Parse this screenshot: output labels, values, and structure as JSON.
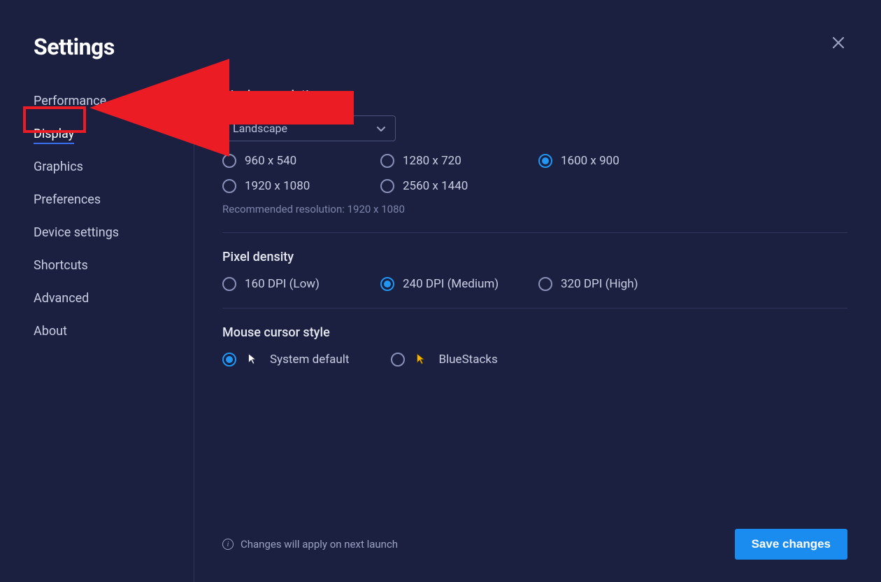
{
  "page_title": "Settings",
  "sidebar": {
    "items": [
      {
        "label": "Performance",
        "active": false
      },
      {
        "label": "Display",
        "active": true
      },
      {
        "label": "Graphics",
        "active": false
      },
      {
        "label": "Preferences",
        "active": false
      },
      {
        "label": "Device settings",
        "active": false
      },
      {
        "label": "Shortcuts",
        "active": false
      },
      {
        "label": "Advanced",
        "active": false
      },
      {
        "label": "About",
        "active": false
      }
    ]
  },
  "display": {
    "resolution": {
      "title": "Display resolution",
      "selector_label": "Landscape",
      "options": [
        {
          "label": "960 x 540",
          "selected": false
        },
        {
          "label": "1280 x 720",
          "selected": false
        },
        {
          "label": "1600 x 900",
          "selected": true
        },
        {
          "label": "1920 x 1080",
          "selected": false
        },
        {
          "label": "2560 x 1440",
          "selected": false
        }
      ],
      "hint": "Recommended resolution: 1920 x 1080"
    },
    "pixel_density": {
      "title": "Pixel density",
      "options": [
        {
          "label": "160 DPI (Low)",
          "selected": false
        },
        {
          "label": "240 DPI (Medium)",
          "selected": true
        },
        {
          "label": "320 DPI (High)",
          "selected": false
        }
      ]
    },
    "cursor": {
      "title": "Mouse cursor style",
      "options": [
        {
          "label": "System default",
          "selected": true,
          "icon": "system"
        },
        {
          "label": "BlueStacks",
          "selected": false,
          "icon": "bluestacks"
        }
      ]
    }
  },
  "footer": {
    "notice": "Changes will apply on next launch",
    "save_label": "Save changes"
  },
  "colors": {
    "accent_blue": "#2196f3",
    "button_blue": "#1a8cf0",
    "annotation_red": "#ec1c24",
    "bg": "#1b2040"
  }
}
